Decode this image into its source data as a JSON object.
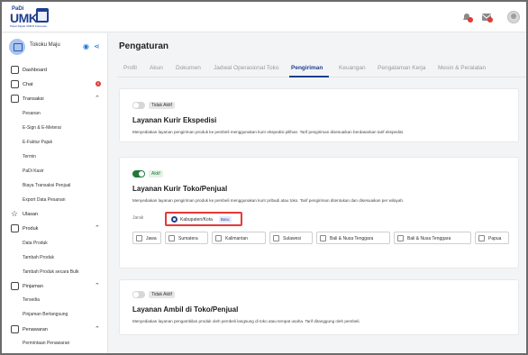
{
  "brand": {
    "top": "PaDi",
    "name": "UMK",
    "tagline": "Pasar Digital UMKM Indonesia"
  },
  "store": {
    "name": "Tokoku Maju"
  },
  "topbar": {
    "notif_icon": "bell-icon",
    "mail_icon": "mail-icon",
    "user_icon": "user-avatar"
  },
  "sidebar": {
    "items": [
      {
        "label": "Dashboard",
        "icon": "home-icon"
      },
      {
        "label": "Chat",
        "icon": "chat-icon",
        "badge": "0"
      },
      {
        "label": "Transaksi",
        "icon": "receipt-icon",
        "expanded": true
      },
      {
        "label": "Ulasan",
        "icon": "star-icon"
      },
      {
        "label": "Produk",
        "icon": "box-icon",
        "expanded": true
      },
      {
        "label": "Pinjaman",
        "icon": "money-icon",
        "expanded": true
      },
      {
        "label": "Penawaran",
        "icon": "tag-icon",
        "expanded": true
      }
    ],
    "transaksi_sub": [
      "Pesanan",
      "E-Sign & E-Meterai",
      "E-Faktur Pajak",
      "Termin",
      "PaDi Kasir",
      "Biaya Transaksi Penjual",
      "Export Data Pesanan"
    ],
    "produk_sub": [
      "Data Produk",
      "Tambah Produk",
      "Tambah Produk secara Bulk"
    ],
    "pinjaman_sub": [
      "Tersedia",
      "Pinjaman Berlangsung"
    ],
    "penawaran_sub": [
      "Permintaan Penawaran"
    ]
  },
  "page": {
    "title": "Pengaturan"
  },
  "tabs": [
    "Profil",
    "Akun",
    "Dokumen",
    "Jadwal Operasional Toko",
    "Pengiriman",
    "Keuangan",
    "Pengalaman Kerja",
    "Mesin & Peralatan"
  ],
  "active_tab": "Pengiriman",
  "cards": {
    "ekspedisi": {
      "status": "Tidak Aktif",
      "title": "Layanan Kurir Ekspedisi",
      "desc": "Menyediakan layanan pengiriman produk ke pembeli menggunakan kurir ekspedisi pilihan. Tarif pengiriman disesuaikan berdasarkan tarif ekspedisi."
    },
    "toko": {
      "status": "Aktif",
      "title": "Layanan Kurir Toko/Penjual",
      "desc": "Menyediakan layanan pengiriman produk ke pembeli menggunakan kurir pribadi atau toko. Tarif pengiriman ditentukan dan disesuaikan per wilayah.",
      "radio_jarak": "Jarak",
      "radio_kabupaten": "Kabupaten/Kota",
      "new_badge": "Baru",
      "regions": [
        "Jawa",
        "Sumatera",
        "Kalimantan",
        "Sulawesi",
        "Bali & Nusa Tenggara",
        "Bali & Nusa Tenggara",
        "Papua"
      ]
    },
    "ambil": {
      "status": "Tidak Aktif",
      "title": "Layanan Ambil di Toko/Penjual",
      "desc": "Menyediakan layanan pengambilan produk oleh pembeli langsung di toko atau tempat usaha. Tarif ditanggung oleh pembeli."
    }
  },
  "colors": {
    "brand": "#1f3f8f",
    "active_toggle": "#1f7a3a",
    "highlight": "#e53935"
  }
}
